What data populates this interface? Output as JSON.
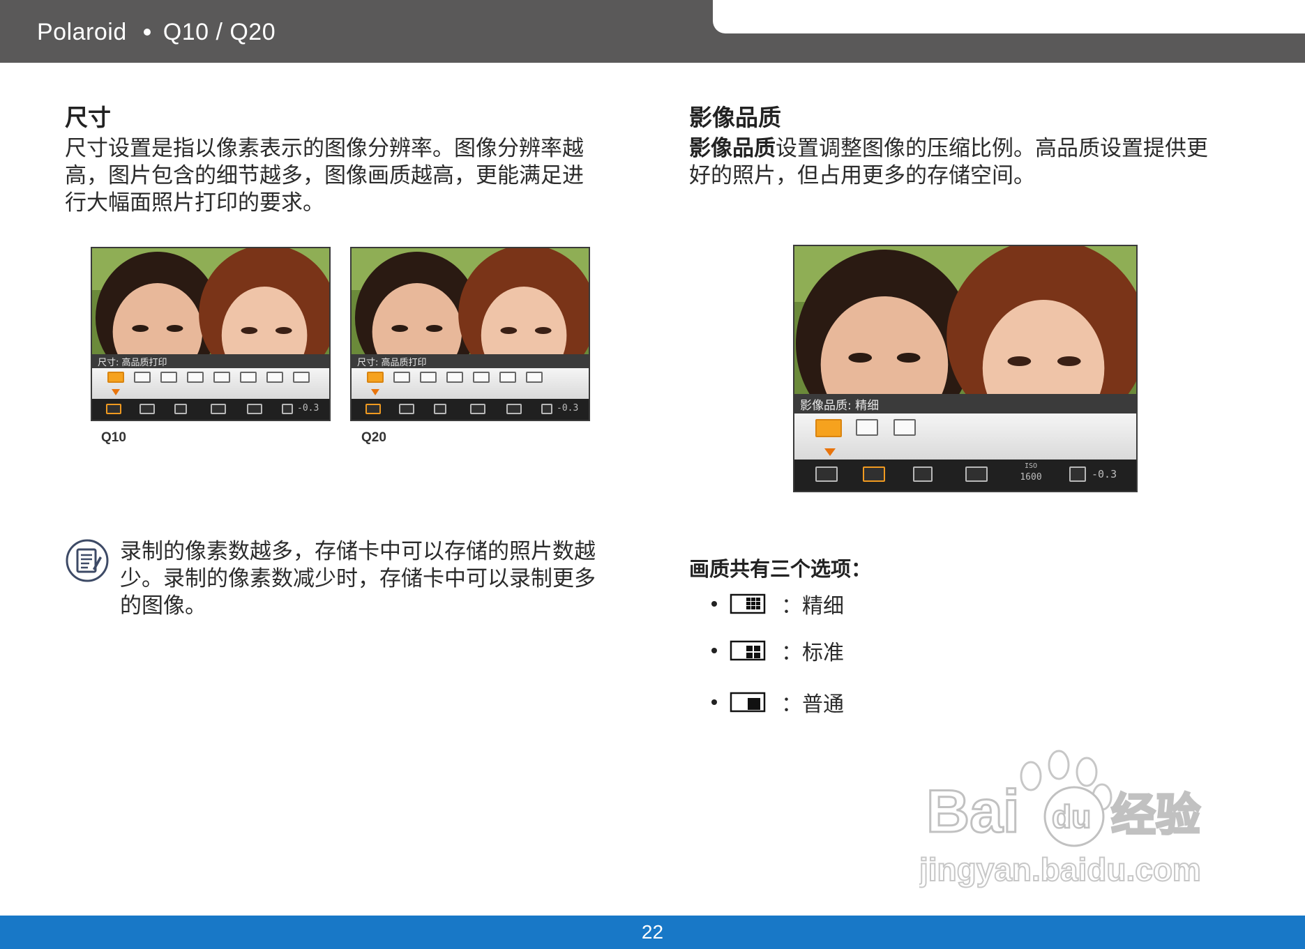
{
  "header": {
    "brand": "Polaroid",
    "model": "Q10 / Q20"
  },
  "size_section": {
    "title": "尺寸",
    "body": "尺寸设置是指以像素表示的图像分辨率。图像分辨率越高，图片包含的细节越多，图像画质越高，更能满足进行大幅面照片打印的要求。",
    "body_lines": [
      "尺寸设置是指以像素表示的图像分辨率。图像分辨率越",
      "高，图片包含的细节越多，图像画质越高，更能满足进",
      "行大幅面照片打印的要求。"
    ],
    "screens": [
      {
        "menu_label": "尺寸: 高品质打印",
        "caption": "Q10",
        "ev": "-0.3"
      },
      {
        "menu_label": "尺寸: 高品质打印",
        "caption": "Q20",
        "ev": "-0.3"
      }
    ]
  },
  "note": {
    "icon": "note-pad-icon",
    "lines": [
      "录制的像素数越多，存储卡中可以存储的照片数越",
      "少。录制的像素数减少时，存储卡中可以录制更多",
      "的图像。"
    ]
  },
  "quality_section": {
    "title": "影像品质",
    "body_bold": "影像品质",
    "body_lines": [
      "设置调整图像的压缩比例。高品质设置提供更",
      "好的照片，但占用更多的存储空间。"
    ],
    "screen": {
      "menu_label": "影像品质: 精细",
      "ev": "-0.3",
      "iso": "ISO",
      "iso_value": "1600"
    },
    "options_title": "画质共有三个选项：",
    "options": [
      {
        "icon": "quality-fine-icon",
        "label": "：精细"
      },
      {
        "icon": "quality-standard-icon",
        "label": "：标准"
      },
      {
        "icon": "quality-normal-icon",
        "label": "：普通"
      }
    ]
  },
  "watermark": {
    "logo": "Bai du 经验",
    "url": "jingyan.baidu.com"
  },
  "footer": {
    "page_number": "22"
  },
  "colors": {
    "header_bg": "#5a5959",
    "footer_bg": "#1878c7",
    "menu_highlight": "#f6a21e",
    "marker_arrow": "#e8740c"
  }
}
